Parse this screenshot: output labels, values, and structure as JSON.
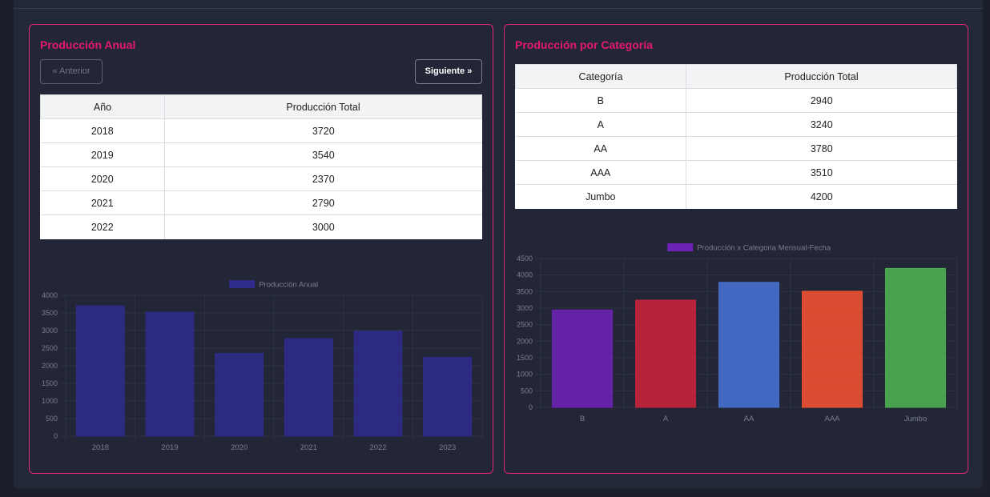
{
  "left_card": {
    "title": "Producción Anual",
    "prev_label": "« Anterior",
    "next_label": "Siguiente »",
    "table": {
      "headers": [
        "Año",
        "Producción Total"
      ],
      "rows": [
        [
          "2018",
          "3720"
        ],
        [
          "2019",
          "3540"
        ],
        [
          "2020",
          "2370"
        ],
        [
          "2021",
          "2790"
        ],
        [
          "2022",
          "3000"
        ]
      ]
    }
  },
  "right_card": {
    "title": "Producción por Categoría",
    "table": {
      "headers": [
        "Categoría",
        "Producción Total"
      ],
      "rows": [
        [
          "B",
          "2940"
        ],
        [
          "A",
          "3240"
        ],
        [
          "AA",
          "3780"
        ],
        [
          "AAA",
          "3510"
        ],
        [
          "Jumbo",
          "4200"
        ]
      ]
    }
  },
  "chart_data": [
    {
      "type": "bar",
      "categories": [
        "2018",
        "2019",
        "2020",
        "2021",
        "2022",
        "2023"
      ],
      "series": [
        {
          "name": "Producción Anual",
          "values": [
            3700,
            3520,
            2350,
            2770,
            2980,
            2240
          ]
        }
      ],
      "colors": [
        "#2e2b8a"
      ],
      "ylim": [
        0,
        4000
      ],
      "yticks": [
        "0",
        "500",
        "1000",
        "1500",
        "2000",
        "2500",
        "3000",
        "3500",
        "4000"
      ],
      "grid": true,
      "legend": "top"
    },
    {
      "type": "bar",
      "categories": [
        "B",
        "A",
        "AA",
        "AAA",
        "Jumbo"
      ],
      "series": [
        {
          "name": "Producción x Categoria Mensual-Fecha",
          "values": [
            2940,
            3240,
            3780,
            3510,
            4200
          ]
        }
      ],
      "colors": [
        "#6c22b5",
        "#c8253b",
        "#4670d0",
        "#f05232",
        "#4caf50"
      ],
      "ylim": [
        0,
        4500
      ],
      "yticks": [
        "0",
        "500",
        "1000",
        "1500",
        "2000",
        "2500",
        "3000",
        "3500",
        "4000",
        "4500"
      ],
      "grid": true,
      "legend": "top"
    }
  ]
}
